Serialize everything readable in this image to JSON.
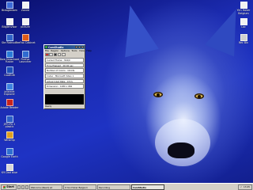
{
  "desktop": {
    "icons_left": [
      {
        "label": "Bidogledom",
        "color": "#3c6ad8"
      },
      {
        "label": "Bilgienvisor",
        "color": "#f2f2f2"
      },
      {
        "label": "Ste Ratnuck",
        "color": "#2f63c8"
      },
      {
        "label": "Dow Download Fusion",
        "color": "#2a7ad8"
      },
      {
        "label": "CoolEdit",
        "color": "#1b4fb8"
      },
      {
        "label": "Internet Explorer",
        "color": "#3d82e0"
      },
      {
        "label": "Adobe Reader",
        "color": "#c8231d"
      },
      {
        "label": "JETCPU 2 plastic",
        "color": "#2c60c8"
      },
      {
        "label": "Winamp",
        "color": "#e0a020"
      },
      {
        "label": "Google Earth",
        "color": "#2f6fd0"
      },
      {
        "label": "K9 Dad blue",
        "color": "#d8d8d8"
      }
    ],
    "icons_col2": [
      {
        "label": "Zoned",
        "color": "#f2f2f2"
      },
      {
        "label": "picture",
        "color": "#f2f2f2"
      },
      {
        "label": "FireFox Cabinet",
        "color": "#e05a18"
      },
      {
        "label": "Firefox Launcher",
        "color": "#2f6ad0"
      }
    ],
    "icons_right": [
      {
        "label": "Yim Hoker Belgium",
        "color": "#f2f2f2"
      },
      {
        "label": "Loc",
        "color": "#f2f2f2"
      },
      {
        "label": "Rec Bin",
        "color": "#d0d0d0"
      }
    ]
  },
  "window": {
    "title": "CamStudio",
    "menu": [
      "File",
      "Region",
      "Options",
      "Tools",
      "View",
      "Help"
    ],
    "rows": [
      "Current Frame : 304/0",
      "Time Elapsed : 00:00 sec",
      "Number of Colors : 16 bits",
      "Codec : Microsoft Video 1",
      "Actual Input Rate : 0 fr/s",
      "Dimension : 1280 x 984"
    ],
    "status": "Ready"
  },
  "taskbar": {
    "start_label": "Start",
    "tasks": [
      "Welcome [Read] ad",
      "9 Yan Hoker Belgium",
      "Recording",
      "CamStudio"
    ],
    "active_task_index": 3,
    "clock": "13:45"
  }
}
